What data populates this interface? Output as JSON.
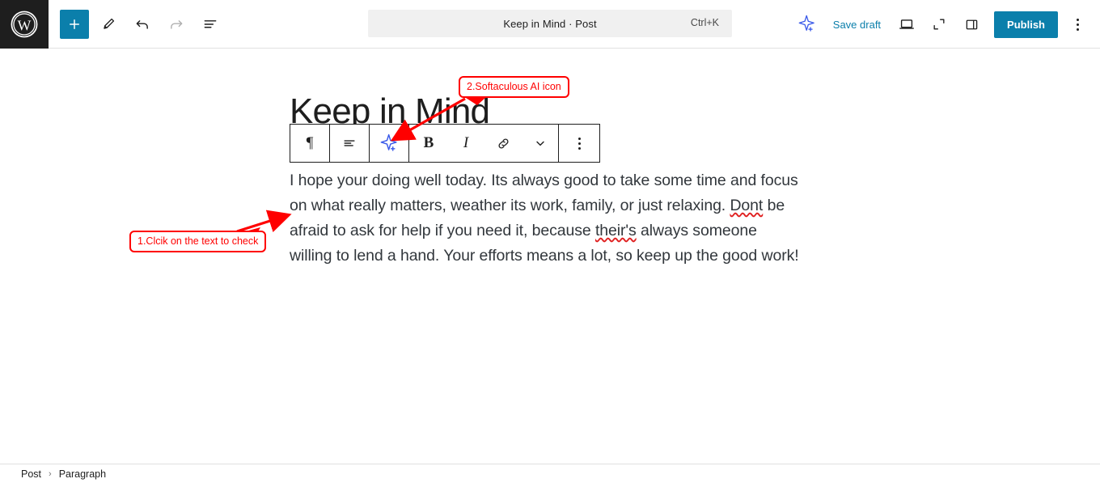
{
  "header": {
    "logo_icon": "wordpress-logo-icon",
    "left_tools": [
      {
        "name": "add-block-button",
        "icon": "plus-icon",
        "label": "Add block",
        "primary": true,
        "disabled": false
      },
      {
        "name": "tools-button",
        "icon": "pencil-icon",
        "label": "Tools",
        "primary": false,
        "disabled": false
      },
      {
        "name": "undo-button",
        "icon": "undo-arrow-icon",
        "label": "Undo",
        "primary": false,
        "disabled": false
      },
      {
        "name": "redo-button",
        "icon": "redo-arrow-icon",
        "label": "Redo",
        "primary": false,
        "disabled": true
      },
      {
        "name": "document-overview-button",
        "icon": "list-view-icon",
        "label": "Document Overview",
        "primary": false,
        "disabled": false
      }
    ],
    "command_bar": {
      "title": "Keep in Mind · Post",
      "shortcut": "Ctrl+K"
    },
    "right_tools": {
      "ai_icon": "softaculous-ai-star-icon",
      "save_draft_label": "Save draft",
      "view_icon": "laptop-preview-icon",
      "fullscreen_icon": "expand-fullscreen-icon",
      "sidebar_icon": "settings-sidebar-icon",
      "publish_label": "Publish",
      "options_icon": "kebab-menu-icon"
    }
  },
  "block_toolbar": {
    "buttons": [
      {
        "name": "block-type-paragraph-button",
        "icon": "paragraph-pilcrow-icon",
        "glyph": "¶"
      },
      {
        "name": "align-text-button",
        "icon": "align-text-icon",
        "glyph": ""
      },
      {
        "name": "softaculous-ai-button",
        "icon": "softaculous-ai-star-icon",
        "glyph": ""
      },
      {
        "name": "bold-button",
        "icon": "bold-icon",
        "glyph": "B"
      },
      {
        "name": "italic-button",
        "icon": "italic-icon",
        "glyph": "I"
      },
      {
        "name": "link-button",
        "icon": "link-chain-icon",
        "glyph": ""
      },
      {
        "name": "more-rich-text-button",
        "icon": "chevron-down-icon",
        "glyph": ""
      },
      {
        "name": "block-options-button",
        "icon": "kebab-menu-icon",
        "glyph": ""
      }
    ]
  },
  "content": {
    "post_title": "Keep in Mind",
    "paragraph": {
      "part1": "I hope your doing well today. Its always good to take some time and focus on what really matters, weather its work, family, or just relaxing. ",
      "misspelled1": "Dont",
      "part2": " be afraid to ask for help if you need it, because ",
      "misspelled2": "their's",
      "part3": " always someone willing to lend a hand. Your efforts means a lot, so keep up the good work!"
    }
  },
  "annotations": [
    {
      "name": "annotation-callout-1",
      "text": "1.Clcik on the text to check"
    },
    {
      "name": "annotation-callout-2",
      "text": "2.Softaculous AI icon"
    }
  ],
  "footer": {
    "breadcrumb": [
      "Post",
      "Paragraph"
    ],
    "separator": "›"
  },
  "colors": {
    "brand_blue": "#0b7fab",
    "annotation_red": "#ff0000",
    "ai_purple": "#3858e9",
    "dark": "#1e1e1e",
    "text": "#32373c"
  }
}
